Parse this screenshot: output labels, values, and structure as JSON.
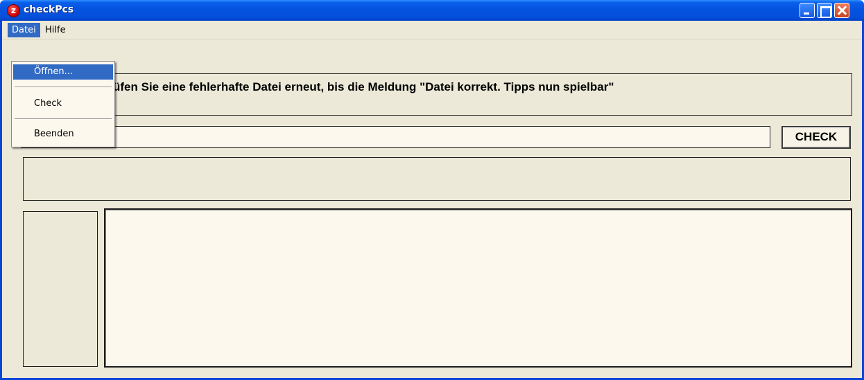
{
  "window": {
    "title": "checkPcs",
    "icon": "app-logo-icon",
    "controls": [
      "minimize-icon",
      "maximize-icon",
      "close-icon"
    ]
  },
  "menubar": {
    "items": [
      {
        "label": "Datei",
        "active": true
      },
      {
        "label": "Hilfe",
        "active": false
      }
    ]
  },
  "dropdown": {
    "items": [
      {
        "label": "Öffnen...",
        "highlighted": true
      },
      {
        "label": "Check",
        "highlighted": false
      },
      {
        "label": "Beenden",
        "highlighted": false
      }
    ]
  },
  "info": {
    "visible_text": "üfen Sie eine fehlerhafte Datei erneut, bis die Meldung \"Datei korrekt. Tipps nun spielbar\""
  },
  "file_field": {
    "value": ""
  },
  "check_button": {
    "label": "CHECK"
  },
  "status": {
    "text": ""
  },
  "output": {
    "text": ""
  },
  "colors": {
    "titlebar": "#0553E0",
    "window_bg": "#ECE9D8",
    "field_bg": "#FCF8ED",
    "highlight": "#316AC5"
  }
}
